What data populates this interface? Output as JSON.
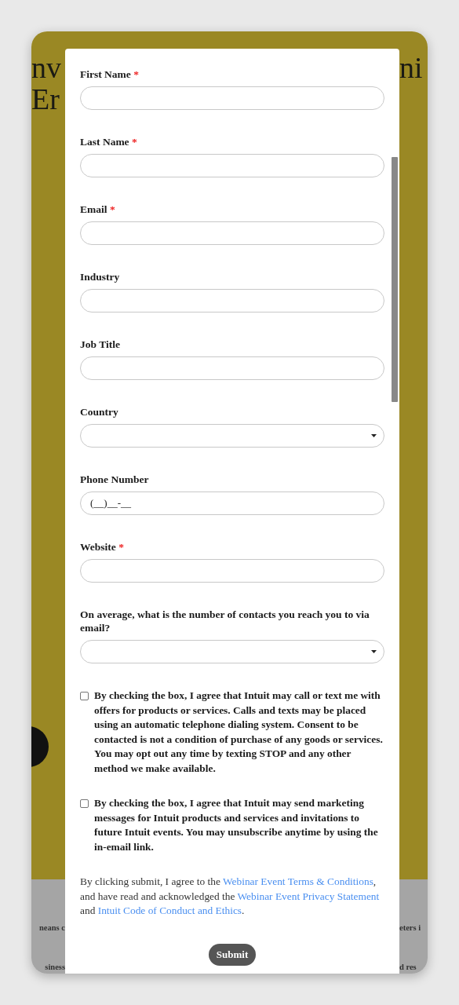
{
  "background": {
    "heading_left": [
      "nv",
      "Er"
    ],
    "heading_right": [
      "ni"
    ],
    "text_left": [
      "neans c",
      "siness"
    ],
    "text_right": [
      "eters i",
      "d res"
    ]
  },
  "form": {
    "fields": [
      {
        "kind": "text",
        "label": "First Name",
        "required_mark": "*"
      },
      {
        "kind": "text",
        "label": "Last Name",
        "required_mark": "*"
      },
      {
        "kind": "text",
        "label": "Email",
        "required_mark": "*"
      },
      {
        "kind": "text",
        "label": "Industry"
      },
      {
        "kind": "text",
        "label": "Job Title"
      },
      {
        "kind": "select",
        "label": "Country"
      },
      {
        "kind": "text",
        "label": "Phone Number",
        "placeholder": "(__)__-__"
      },
      {
        "kind": "text",
        "label": "Website",
        "required_mark": "*"
      },
      {
        "kind": "select",
        "label": "On average, what is the number of contacts you reach you to via email?"
      }
    ],
    "consents": [
      {
        "checked": false,
        "text": "By checking the box, I agree that Intuit may call or text me with offers for products or services. Calls and texts may be placed using an automatic telephone dialing system. Consent to be contacted is not a condition of purchase of any goods or services. You may opt out any time by texting STOP and any other method we make available."
      },
      {
        "checked": false,
        "text": "By checking the box, I agree that Intuit may send marketing messages for Intuit products and services and invitations to future Intuit events. You may unsubscribe anytime by using the in-email link."
      }
    ],
    "disclaimer": [
      {
        "kind": "text",
        "text": "By clicking submit, I agree to the "
      },
      {
        "kind": "link",
        "text": "Webinar Event Terms & Conditions"
      },
      {
        "kind": "text",
        "text": ", and have read and acknowledged the "
      },
      {
        "kind": "link",
        "text": "Webinar Event Privacy Statement"
      },
      {
        "kind": "text",
        "text": " and "
      },
      {
        "kind": "link",
        "text": "Intuit Code of Conduct and Ethics"
      },
      {
        "kind": "text",
        "text": "."
      }
    ],
    "submit": "Submit"
  }
}
